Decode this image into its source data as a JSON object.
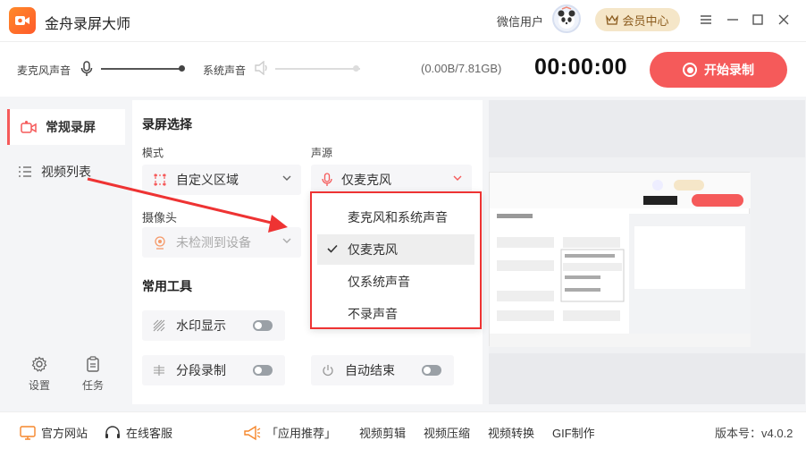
{
  "app": {
    "title": "金舟录屏大师",
    "user_name": "微信用户",
    "vip_label": "会员中心"
  },
  "audio": {
    "mic_label": "麦克风声音",
    "system_label": "系统声音",
    "mic_level": 0.98,
    "system_level": 0.95
  },
  "recording": {
    "storage": "(0.00B/7.81GB)",
    "timer": "00:00:00",
    "start_label": "开始录制"
  },
  "sidebar": {
    "items": [
      {
        "label": "常规录屏",
        "icon": "screen-record-icon"
      },
      {
        "label": "视频列表",
        "icon": "list-icon"
      }
    ],
    "bottom": [
      {
        "label": "设置",
        "icon": "gear-icon"
      },
      {
        "label": "任务",
        "icon": "task-icon"
      }
    ]
  },
  "panel": {
    "section_title": "录屏选择",
    "mode_label": "模式",
    "mode_value": "自定义区域",
    "source_label": "声源",
    "source_value": "仅麦克风",
    "camera_label": "摄像头",
    "camera_value": "未检测到设备",
    "tools_title": "常用工具",
    "tools": [
      {
        "label": "水印显示",
        "icon": "watermark-icon"
      },
      {
        "label": "分段录制",
        "icon": "segment-icon"
      },
      {
        "label": "自动结束",
        "icon": "power-icon"
      }
    ]
  },
  "dropdown": {
    "options": [
      "麦克风和系统声音",
      "仅麦克风",
      "仅系统声音",
      "不录声音"
    ],
    "selected_index": 1
  },
  "footer": {
    "links": [
      "官方网站",
      "在线客服",
      "「应用推荐」",
      "视频剪辑",
      "视频压缩",
      "视频转换",
      "GIF制作"
    ],
    "version": "版本号：v4.0.2"
  },
  "colors": {
    "accent": "#f55a5a",
    "vip_bg": "#f5e6c8",
    "highlight": "#ee3333"
  }
}
